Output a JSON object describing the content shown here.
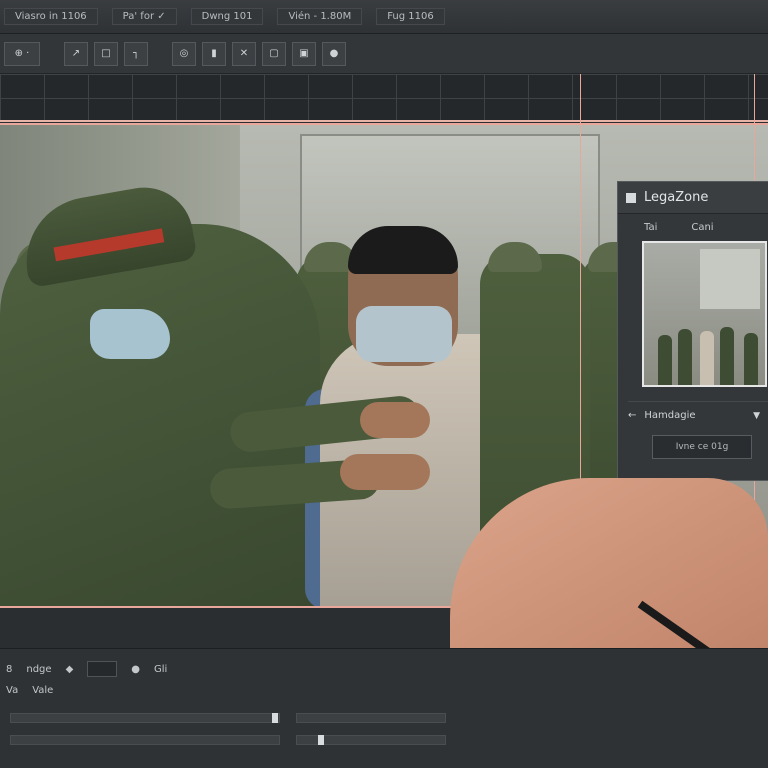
{
  "topbar": {
    "items": [
      "Viasro in 1106",
      "Pa' for ✓",
      "Dwng 101",
      "Vién - 1.80M",
      "Fug 1106"
    ]
  },
  "toolbar": {
    "buttons": [
      {
        "icon": "layer-box-icon",
        "label": "⊕ ·"
      },
      {
        "icon": "arrow-icon",
        "label": "↗"
      },
      {
        "icon": "doc-icon",
        "label": "□"
      },
      {
        "icon": "step-icon",
        "label": "┐"
      },
      {
        "icon": "target-icon",
        "label": "◎"
      },
      {
        "icon": "lock-icon",
        "label": "▮"
      },
      {
        "icon": "transform-icon",
        "label": "✕"
      },
      {
        "icon": "crop-icon",
        "label": "▢"
      },
      {
        "icon": "frame-icon",
        "label": "▣"
      },
      {
        "icon": "record-icon",
        "label": "●"
      }
    ]
  },
  "panel": {
    "title": "LegaZone",
    "tabs": [
      "Tai",
      "Cani"
    ],
    "row_label": "Hamdagie",
    "row_icon_left": "←",
    "row_dropdown": "▼",
    "input_value": "Ivne ce 01g"
  },
  "bottom": {
    "row1": {
      "left": "8",
      "label": "ndge",
      "icons": [
        "◆",
        "●",
        "Gli"
      ]
    },
    "row2": {
      "labels": [
        "Va",
        "Vale"
      ]
    }
  },
  "colors": {
    "guide": "#e9a79b",
    "panel_bg": "#34373a",
    "toolbar_bg": "#333639"
  }
}
